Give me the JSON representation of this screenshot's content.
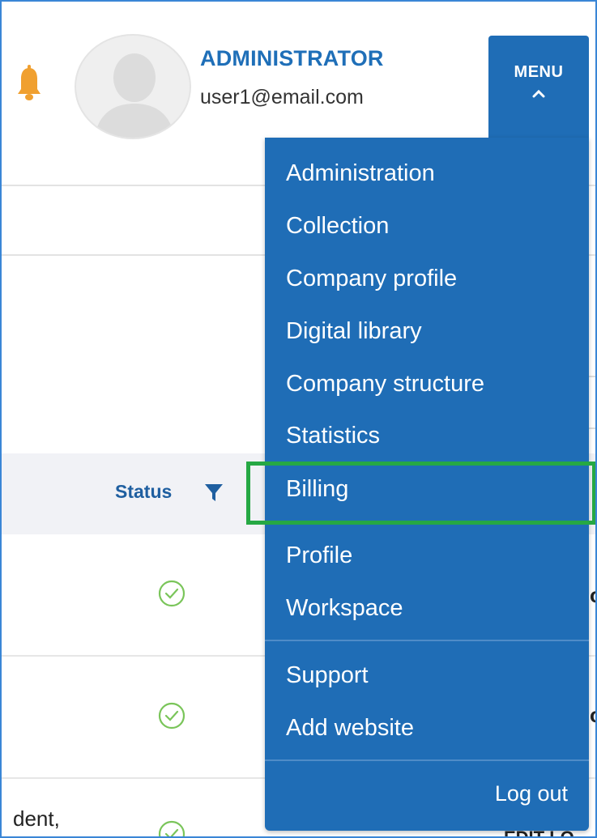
{
  "header": {
    "role": "ADMINISTRATOR",
    "email": "user1@email.com",
    "menu_label": "MENU"
  },
  "table": {
    "status_header": "Status",
    "fragment_text": "dent,",
    "fragment_cut_1": "o",
    "fragment_cut_2": "o",
    "fragment_cut_3": "EDIT LO"
  },
  "menu": {
    "items": [
      {
        "label": "Administration"
      },
      {
        "label": "Collection"
      },
      {
        "label": "Company profile"
      },
      {
        "label": "Digital library"
      },
      {
        "label": "Company structure"
      },
      {
        "label": "Statistics"
      },
      {
        "label": "Billing"
      },
      {
        "label": "Profile"
      },
      {
        "label": "Workspace"
      },
      {
        "label": "Support"
      },
      {
        "label": "Add website"
      }
    ],
    "logout": "Log out"
  },
  "colors": {
    "accent": "#1f6db6",
    "highlight": "#26a844",
    "bell": "#f0a030",
    "check": "#7ac55a"
  }
}
